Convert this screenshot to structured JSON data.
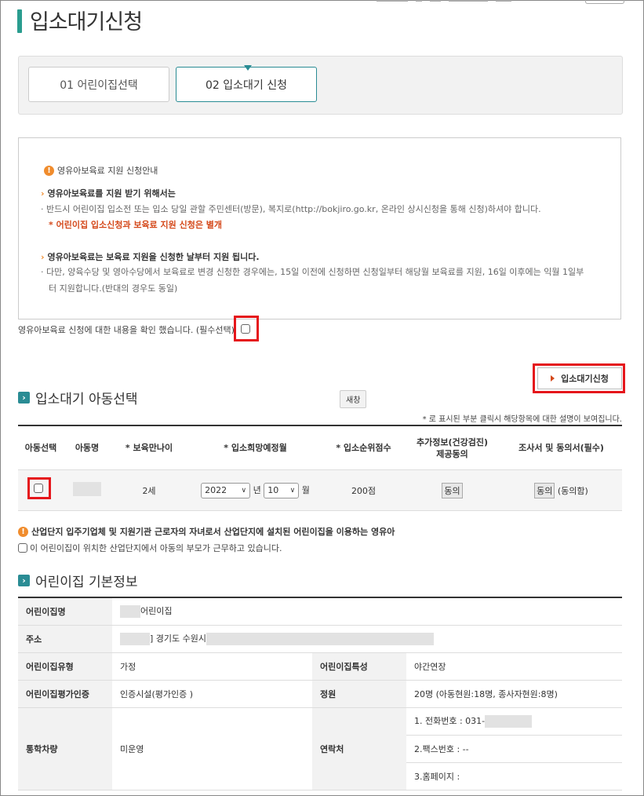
{
  "page": {
    "title": "입소대기신청"
  },
  "steps": [
    {
      "label": "01 어린이집선택"
    },
    {
      "label": "02 입소대기 신청"
    }
  ],
  "notice": {
    "heading": "영유아보육료 지원 신청안내",
    "block1_title": "영유아보육료를 지원 받기 위해서는",
    "block1_text": "반드시 어린이집 입소전 또는 입소 당일 관할 주민센터(방문), 복지로(http://bokjiro.go.kr, 온라인 상시신청을 통해 신청)하셔야 합니다.",
    "block1_warning": "* 어린이집 입소신청과 보육료 지원 신청은 별개",
    "block2_title": "영유아보육료는 보육료 지원을 신청한 날부터 지원 됩니다.",
    "block2_text1": "다만, 양육수당 및 영아수당에서 보육료로 변경 신청한 경우에는, 15일 이전에 신청하면 신청일부터 해당월 보육료를 지원, 16일 이후에는 익월 1일부",
    "block2_text2": "터 지원합니다.(반대의 경우도 동일)"
  },
  "confirm": {
    "label": "영유아보육료 신청에 대한 내용을 확인 했습니다. (필수선택)"
  },
  "apply_button": {
    "label": "입소대기신청"
  },
  "child_section": {
    "title": "입소대기 아동선택",
    "tooltip": "새창",
    "note": "* 로 표시된 부분 클릭시 해당항목에 대한 설명이 보여집니다.",
    "headers": [
      "아동선택",
      "아동명",
      "* 보육만나이",
      "* 입소희망예정월",
      "* 입소순위점수",
      "추가정보(건강검진)",
      "제공동의",
      "조사서 및 동의서(필수)"
    ],
    "row": {
      "age": "2세",
      "year": "2022",
      "year_unit": "년",
      "month": "10",
      "month_unit": "월",
      "score": "200점",
      "agree": "동의",
      "agree2": "동의",
      "agree2_status": "(동의함)"
    }
  },
  "industrial": {
    "warning": "산업단지 입주기업체 및 지원기관 근로자의 자녀로서 산업단지에 설치된 어린이집을 이용하는 영유아",
    "checkbox_label": "이 어린이집이 위치한 산업단지에서 아동의 부모가 근무하고 있습니다."
  },
  "basic_info": {
    "title": "어린이집 기본정보",
    "name_label": "어린이집명",
    "name_value": "어린이집",
    "address_label": "주소",
    "address_value": "] 경기도 수원시",
    "type_label": "어린이집유형",
    "type_value": "가정",
    "feature_label": "어린이집특성",
    "feature_value": "야간연장",
    "eval_label": "어린이집평가인증",
    "eval_value": "인증시설(평가인증 )",
    "capacity_label": "정원",
    "capacity_value": "20명 (아동현원:18명, 종사자현원:8명)",
    "bus_label": "통학차량",
    "bus_value": "미운영",
    "contact_label": "연락처",
    "phone": "1. 전화번호 : 031-",
    "fax": "2.팩스번호 : --",
    "homepage": "3.홈페이지 :"
  }
}
